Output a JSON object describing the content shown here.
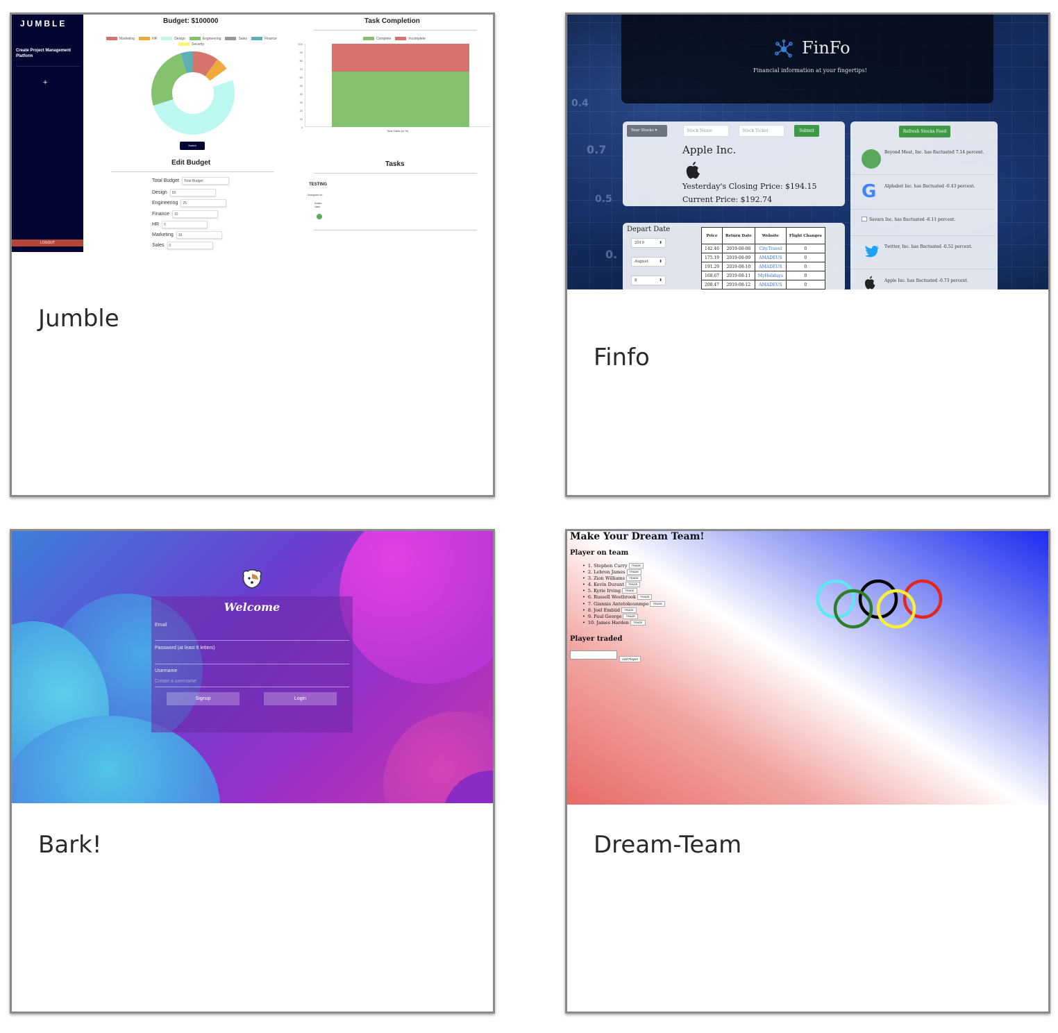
{
  "cards": [
    {
      "title": "Jumble",
      "preview": {
        "logo": "JUMBLE",
        "sidebar_link": "Create Project Management Platform",
        "add_icon": "+",
        "logout": "LOGOUT",
        "budget_title": "Budget: $100000",
        "budget_legend": [
          "Marketing",
          "HR",
          "Design",
          "Engineering",
          "Sales",
          "Finance",
          "Security"
        ],
        "switch_label": "Switch",
        "edit_budget_title": "Edit Budget",
        "form": [
          {
            "label": "Total Budget",
            "value": "",
            "placeholder": "Total Budget"
          },
          {
            "label": "Design",
            "value": "50"
          },
          {
            "label": "Engineering",
            "value": "25"
          },
          {
            "label": "Finance",
            "value": "10"
          },
          {
            "label": "HR",
            "value": "5"
          },
          {
            "label": "Marketing",
            "value": "10"
          },
          {
            "label": "Sales",
            "value": "0"
          }
        ],
        "task_title": "Task Completion",
        "task_legend": [
          "Complete",
          "Incomplete"
        ],
        "task_axis": [
          "100",
          "90",
          "80",
          "70",
          "60",
          "50",
          "40",
          "30",
          "20",
          "10",
          "0"
        ],
        "task_xlabel": "Total Tasks (in %)",
        "tasks_title": "Tasks",
        "task_name": "TESTING",
        "assigned_label": "Assigned to:",
        "assignees": "Adam Jake"
      }
    },
    {
      "title": "Finfo",
      "preview": {
        "brand": "FinFo",
        "tagline": "Financial information at your fingertips!",
        "your_stocks": "Your Stocks",
        "stock_name_placeholder": "Stock Name",
        "stock_ticker_placeholder": "Stock Ticker",
        "submit": "Submit",
        "company": "Apple Inc.",
        "closing": "Yesterday's Closing Price: $194.15",
        "current": "Current Price: $192.74",
        "refresh": "Refresh Stocks Feed",
        "news": [
          {
            "icon": "beyond-meat-logo",
            "text": "Beyond Meat, Inc. has fluctuated 7.14 percent."
          },
          {
            "icon": "google-logo",
            "text": "Alphabet Inc. has fluctuated -0.43 percent."
          },
          {
            "icon": "broken-image-icon",
            "text": "Savara Inc. has fluctuated -6.11 percent."
          },
          {
            "icon": "twitter-logo",
            "text": "Twitter, Inc. has fluctuated -0.52 percent."
          },
          {
            "icon": "apple-logo",
            "text": "Apple Inc. has fluctuated -0.73 percent."
          }
        ],
        "depart_label": "Depart Date",
        "selects": [
          "2019",
          "August",
          "8"
        ],
        "table_headers": [
          "Price",
          "Return Date",
          "Website",
          "Flight Changes"
        ],
        "table_rows": [
          [
            "142.46",
            "2019-08-08",
            "City.Travel",
            "0"
          ],
          [
            "175.19",
            "2019-08-09",
            "AMADEUS",
            "0"
          ],
          [
            "191.29",
            "2019-08-10",
            "AMADEUS",
            "0"
          ],
          [
            "168.67",
            "2019-08-11",
            "MyHolidays",
            "0"
          ],
          [
            "208.47",
            "2019-08-12",
            "AMADEUS",
            "0"
          ]
        ]
      }
    },
    {
      "title": "Bark!",
      "preview": {
        "welcome": "Welcome",
        "email_label": "Email",
        "password_label": "Password (at least 6 letters)",
        "username_label": "Username",
        "username_placeholder": "Create a username",
        "signup": "Signup",
        "login": "Login"
      }
    },
    {
      "title": "Dream-Team",
      "preview": {
        "heading": "Make Your Dream Team!",
        "players_heading": "Player on team",
        "players": [
          "1. Stephen Curry",
          "2. Lebron James",
          "3. Zion Williams",
          "4. Kevin Durant",
          "5. Kyrie Irving",
          "6. Russell Westbrook",
          "7. Giannis Antetokounmpo",
          "8. Joel Embiid",
          "9. Paul George",
          "10. James Harden"
        ],
        "trade_label": "TRADE",
        "traded_heading": "Player traded",
        "add_player": "Add Player!",
        "ring_colors": [
          "#5ee7f0",
          "#000000",
          "#e3261f",
          "#2d7d2a",
          "#f7f03a"
        ]
      }
    }
  ]
}
